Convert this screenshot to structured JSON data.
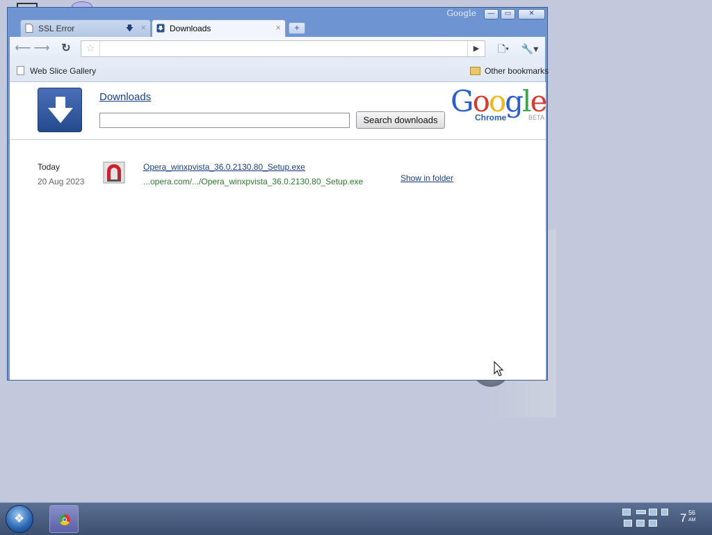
{
  "browser": {
    "brand": "Google",
    "tabs": [
      {
        "label": "SSL Error",
        "active": false
      },
      {
        "label": "Downloads",
        "active": true
      }
    ],
    "window_controls": {
      "minimize": "—",
      "maximize": "▭",
      "close": "✕"
    },
    "omnibox": {
      "value": ""
    },
    "bookmarks_bar": {
      "left_item": "Web Slice Gallery",
      "right_item": "Other bookmarks"
    }
  },
  "downloads_page": {
    "title": "Downloads",
    "search": {
      "value": "",
      "button_label": "Search downloads"
    },
    "logo": {
      "word": "Google",
      "product": "Chrome",
      "badge": "BETA"
    },
    "items": [
      {
        "day": "Today",
        "date": "20 Aug 2023",
        "filename": "Opera_winxpvista_36.0.2130.80_Setup.exe",
        "url": "...opera.com/.../Opera_winxpvista_36.0.2130.80_Setup.exe",
        "action": "Show in folder"
      }
    ]
  },
  "taskbar": {
    "clock": {
      "hour": "7",
      "minutes": "56",
      "ampm": "AM"
    }
  },
  "colors": {
    "link": "#1a3f8a",
    "url_green": "#2a7a2a",
    "window_frame": "#6e95d2",
    "desktop": "#c3c9dc"
  }
}
